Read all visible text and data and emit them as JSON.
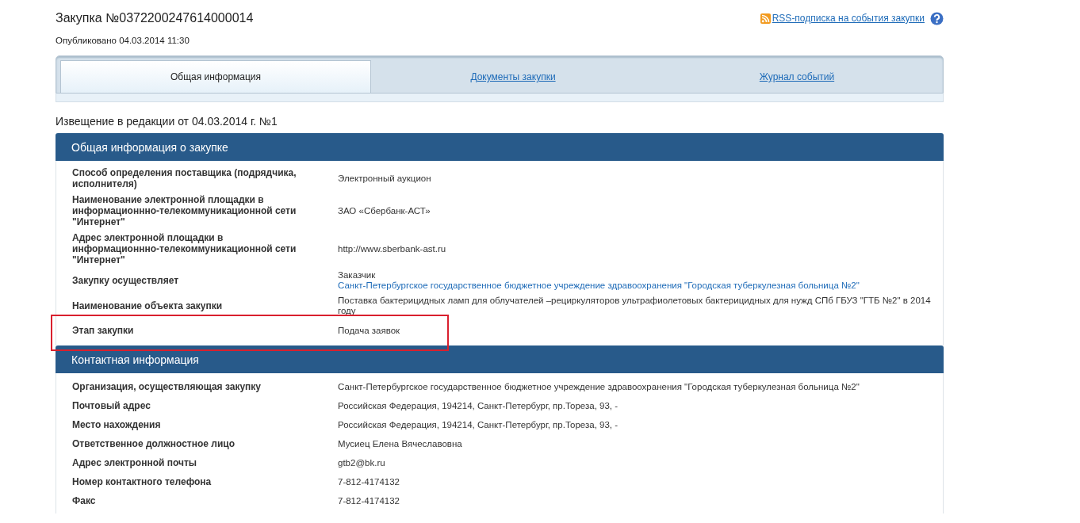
{
  "header": {
    "title": "Закупка №0372200247614000014",
    "published": "Опубликовано 04.03.2014 11:30",
    "rss_link": "RSS-подписка на события закупки"
  },
  "tabs": [
    {
      "label": "Общая информация",
      "selected": true
    },
    {
      "label": "Документы закупки",
      "selected": false
    },
    {
      "label": "Журнал событий",
      "selected": false
    }
  ],
  "notice": "Извещение в редакции от 04.03.2014 г. №1",
  "sections": [
    {
      "title": "Общая информация о закупке",
      "rows": [
        {
          "label": "Способ определения поставщика (подрядчика, исполнителя)",
          "highlighted": false,
          "values": [
            {
              "kind": "text",
              "text": "Электронный аукцион"
            }
          ]
        },
        {
          "label": "Наименование электронной площадки в информационнно-телекоммуникационной сети \"Интернет\"",
          "highlighted": false,
          "values": [
            {
              "kind": "text",
              "text": "ЗАО «Сбербанк-АСТ»"
            }
          ]
        },
        {
          "label": "Адрес электронной площадки в информационнно-телекоммуникационной сети \"Интернет\"",
          "highlighted": false,
          "values": [
            {
              "kind": "text",
              "text": "http://www.sberbank-ast.ru"
            }
          ]
        },
        {
          "label": "Закупку осуществляет",
          "highlighted": false,
          "values": [
            {
              "kind": "text",
              "text": "Заказчик"
            },
            {
              "kind": "link",
              "text": "Санкт-Петербургское государственное бюджетное учреждение здравоохранения \"Городская туберкулезная больница №2\""
            }
          ]
        },
        {
          "label": "Наименование объекта закупки",
          "highlighted": false,
          "values": [
            {
              "kind": "text",
              "text": "Поставка бактерицидных ламп для облучателей –рециркуляторов ультрафиолетовых бактерицидных для нужд СПб ГБУЗ \"ГТБ №2\" в 2014 году"
            }
          ]
        },
        {
          "label": "Этап закупки",
          "highlighted": true,
          "values": [
            {
              "kind": "text",
              "text": "Подача заявок"
            }
          ]
        }
      ]
    },
    {
      "title": "Контактная информация",
      "rows": [
        {
          "label": "Организация, осуществляющая закупку",
          "highlighted": false,
          "values": [
            {
              "kind": "text",
              "text": "Санкт-Петербургское государственное бюджетное учреждение здравоохранения \"Городская туберкулезная больница №2\""
            }
          ]
        },
        {
          "label": "Почтовый адрес",
          "highlighted": false,
          "values": [
            {
              "kind": "text",
              "text": "Российская Федерация, 194214, Санкт-Петербург, пр.Тореза, 93, -"
            }
          ]
        },
        {
          "label": "Место нахождения",
          "highlighted": false,
          "values": [
            {
              "kind": "text",
              "text": "Российская Федерация, 194214, Санкт-Петербург, пр.Тореза, 93, -"
            }
          ]
        },
        {
          "label": "Ответственное должностное лицо",
          "highlighted": false,
          "values": [
            {
              "kind": "text",
              "text": "Мусиец Елена Вячеславовна"
            }
          ]
        },
        {
          "label": "Адрес электронной почты",
          "highlighted": false,
          "values": [
            {
              "kind": "text",
              "text": "gtb2@bk.ru"
            }
          ]
        },
        {
          "label": "Номер контактного телефона",
          "highlighted": false,
          "values": [
            {
              "kind": "text",
              "text": "7-812-4174132"
            }
          ]
        },
        {
          "label": "Факс",
          "highlighted": false,
          "values": [
            {
              "kind": "text",
              "text": "7-812-4174132"
            }
          ]
        }
      ]
    }
  ]
}
